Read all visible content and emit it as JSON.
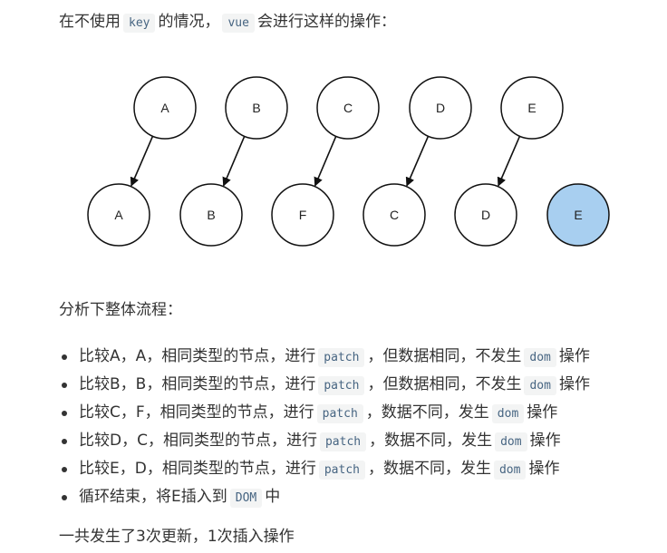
{
  "intro": {
    "prefix": "在不使用",
    "code1": "key",
    "middle": "的情况，",
    "code2": "vue",
    "suffix": "会进行这样的操作："
  },
  "diagram": {
    "top_row": [
      "A",
      "B",
      "C",
      "D",
      "E"
    ],
    "bottom_row": [
      "A",
      "B",
      "F",
      "C",
      "D",
      "E"
    ],
    "highlight_color": "#a8cff0",
    "edge_count": 5
  },
  "flow_heading": "分析下整体流程：",
  "steps": [
    {
      "before": "比较A，A，相同类型的节点，进行",
      "code": "patch",
      "middle": "，但数据相同，不发生",
      "code2": "dom",
      "after": "操作"
    },
    {
      "before": "比较B，B，相同类型的节点，进行",
      "code": "patch",
      "middle": "，但数据相同，不发生",
      "code2": "dom",
      "after": "操作"
    },
    {
      "before": "比较C，F，相同类型的节点，进行",
      "code": "patch",
      "middle": "，数据不同，发生",
      "code2": "dom",
      "after": "操作"
    },
    {
      "before": "比较D，C，相同类型的节点，进行",
      "code": "patch",
      "middle": "，数据不同，发生",
      "code2": "dom",
      "after": "操作"
    },
    {
      "before": "比较E，D，相同类型的节点，进行",
      "code": "patch",
      "middle": "，数据不同，发生",
      "code2": "dom",
      "after": "操作"
    }
  ],
  "last_step": {
    "before": "循环结束，将E插入到",
    "code": "DOM",
    "after": "中"
  },
  "summary": "一共发生了3次更新，1次插入操作"
}
